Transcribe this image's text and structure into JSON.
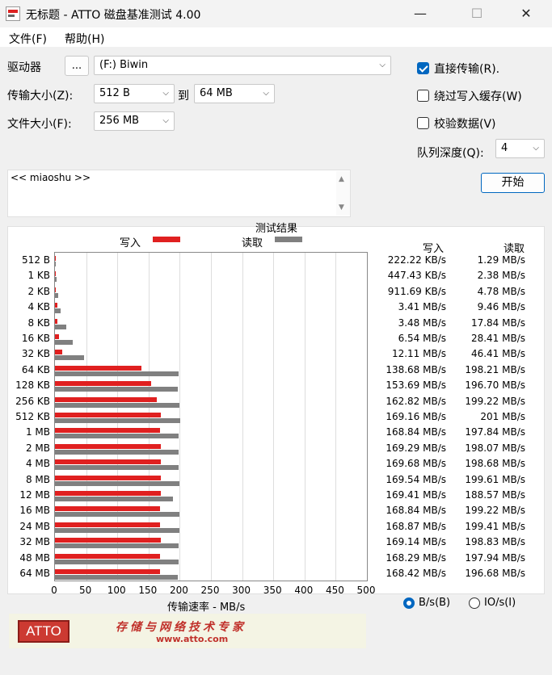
{
  "window": {
    "title": "无标题 - ATTO 磁盘基准测试 4.00",
    "minimize_glyph": "—",
    "maximize_glyph": "☐",
    "close_glyph": "✕"
  },
  "menu": {
    "file": "文件(F)",
    "help": "帮助(H)"
  },
  "controls": {
    "drive_label": "驱动器",
    "browse_label": "...",
    "drive_value": "(F:) Biwin",
    "transfer_size_label": "传输大小(Z):",
    "transfer_from": "512 B",
    "to_label": "到",
    "transfer_to": "64 MB",
    "file_size_label": "文件大小(F):",
    "file_size_value": "256 MB",
    "direct_io_label": "直接传输(R).",
    "direct_io_checked": true,
    "bypass_write_cache_label": "绕过写入缓存(W)",
    "bypass_write_cache_checked": false,
    "verify_data_label": "校验数据(V)",
    "verify_data_checked": false,
    "queue_depth_label": "队列深度(Q):",
    "queue_depth_value": "4",
    "start_label": "开始",
    "description": "<< miaoshu >>"
  },
  "results": {
    "header": "测试结果",
    "legend_write": "写入",
    "legend_read": "读取",
    "col_write": "写入",
    "col_read": "读取",
    "x_axis_label": "传输速率 - MB/s",
    "unit_bytes_label": "B/s(B)",
    "unit_io_label": "IO/s(I)",
    "unit_selected": "B/s"
  },
  "chart_data": {
    "type": "bar",
    "orientation": "horizontal",
    "categories": [
      "512 B",
      "1 KB",
      "2 KB",
      "4 KB",
      "8 KB",
      "16 KB",
      "32 KB",
      "64 KB",
      "128 KB",
      "256 KB",
      "512 KB",
      "1 MB",
      "2 MB",
      "4 MB",
      "8 MB",
      "12 MB",
      "16 MB",
      "24 MB",
      "32 MB",
      "48 MB",
      "64 MB"
    ],
    "series": [
      {
        "name": "写入",
        "color": "#e02020",
        "values": [
          0.22,
          0.45,
          0.91,
          3.41,
          3.48,
          6.54,
          12.11,
          138.68,
          153.69,
          162.82,
          169.16,
          168.84,
          169.29,
          169.68,
          169.54,
          169.41,
          168.84,
          168.87,
          169.14,
          168.29,
          168.42
        ],
        "labels": [
          "222.22 KB/s",
          "447.43 KB/s",
          "911.69 KB/s",
          "3.41 MB/s",
          "3.48 MB/s",
          "6.54 MB/s",
          "12.11 MB/s",
          "138.68 MB/s",
          "153.69 MB/s",
          "162.82 MB/s",
          "169.16 MB/s",
          "168.84 MB/s",
          "169.29 MB/s",
          "169.68 MB/s",
          "169.54 MB/s",
          "169.41 MB/s",
          "168.84 MB/s",
          "168.87 MB/s",
          "169.14 MB/s",
          "168.29 MB/s",
          "168.42 MB/s"
        ]
      },
      {
        "name": "读取",
        "color": "#808080",
        "values": [
          1.29,
          2.38,
          4.78,
          9.46,
          17.84,
          28.41,
          46.41,
          198.21,
          196.7,
          199.22,
          201,
          197.84,
          198.07,
          198.68,
          199.61,
          188.57,
          199.22,
          199.41,
          198.83,
          197.94,
          196.68
        ],
        "labels": [
          "1.29 MB/s",
          "2.38 MB/s",
          "4.78 MB/s",
          "9.46 MB/s",
          "17.84 MB/s",
          "28.41 MB/s",
          "46.41 MB/s",
          "198.21 MB/s",
          "196.70 MB/s",
          "199.22 MB/s",
          "201 MB/s",
          "197.84 MB/s",
          "198.07 MB/s",
          "198.68 MB/s",
          "199.61 MB/s",
          "188.57 MB/s",
          "199.22 MB/s",
          "199.41 MB/s",
          "198.83 MB/s",
          "197.94 MB/s",
          "196.68 MB/s"
        ]
      }
    ],
    "xlim": [
      0,
      500
    ],
    "xticks": [
      0,
      50,
      100,
      150,
      200,
      250,
      300,
      350,
      400,
      450,
      500
    ],
    "xlabel": "传输速率 - MB/s",
    "title": "测试结果",
    "legend": "top",
    "grid": true
  },
  "banner": {
    "logo": "ATTO",
    "tagline": "存储与网络技术专家",
    "url": "www.atto.com"
  }
}
